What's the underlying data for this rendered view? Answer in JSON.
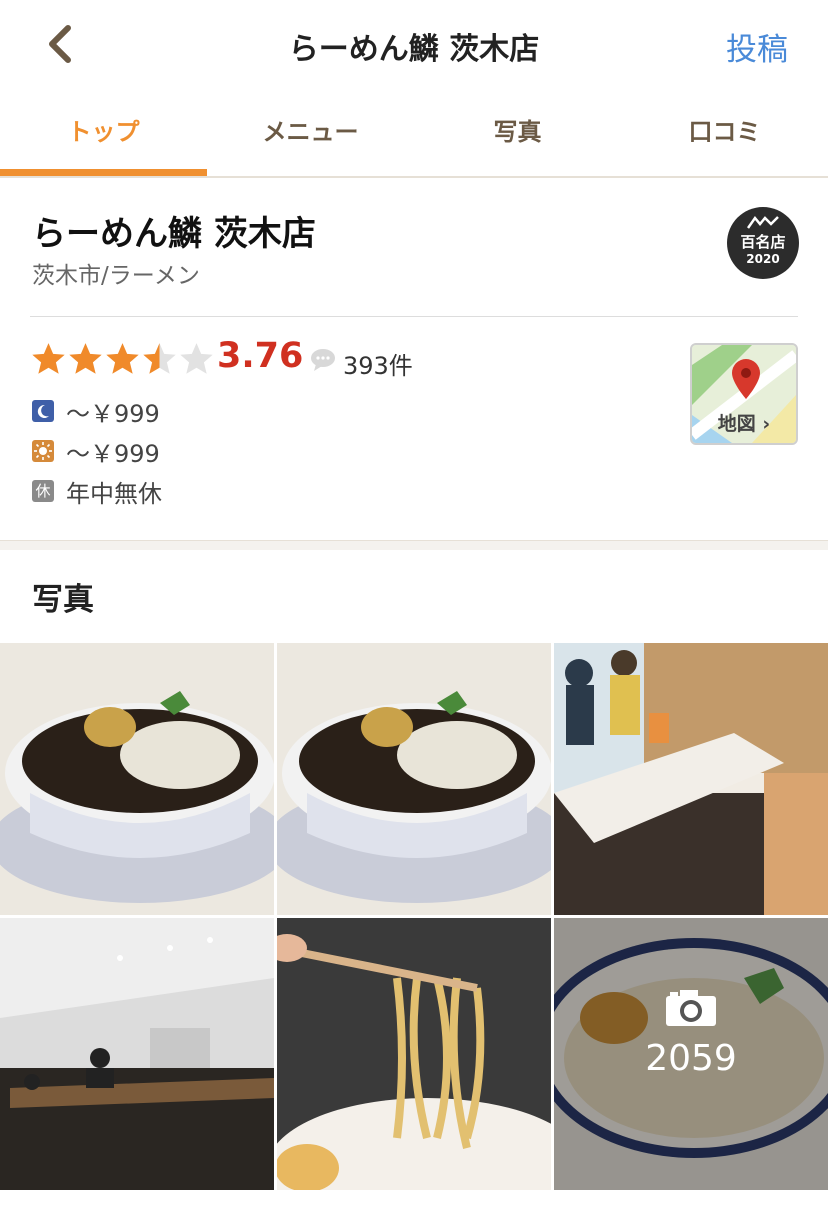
{
  "header": {
    "title": "らーめん鱗 茨木店",
    "post_label": "投稿"
  },
  "tabs": [
    {
      "label": "トップ"
    },
    {
      "label": "メニュー"
    },
    {
      "label": "写真"
    },
    {
      "label": "口コミ"
    }
  ],
  "shop": {
    "name": "らーめん鱗 茨木店",
    "area_genre": "茨木市/ラーメン",
    "badge_text": "百名店",
    "badge_year": "2020",
    "rating": "3.76",
    "rating_stars_value": 3.76,
    "review_count": "393件",
    "dinner_price": "～￥999",
    "lunch_price": "～￥999",
    "holiday_icon": "休",
    "holiday": "年中無休",
    "map_label": "地図 ›"
  },
  "photos": {
    "heading": "写真",
    "total_count": "2059"
  },
  "colors": {
    "accent": "#f09030",
    "rating": "#d03020",
    "link": "#4a8ad8",
    "star": "#f08a2a"
  }
}
